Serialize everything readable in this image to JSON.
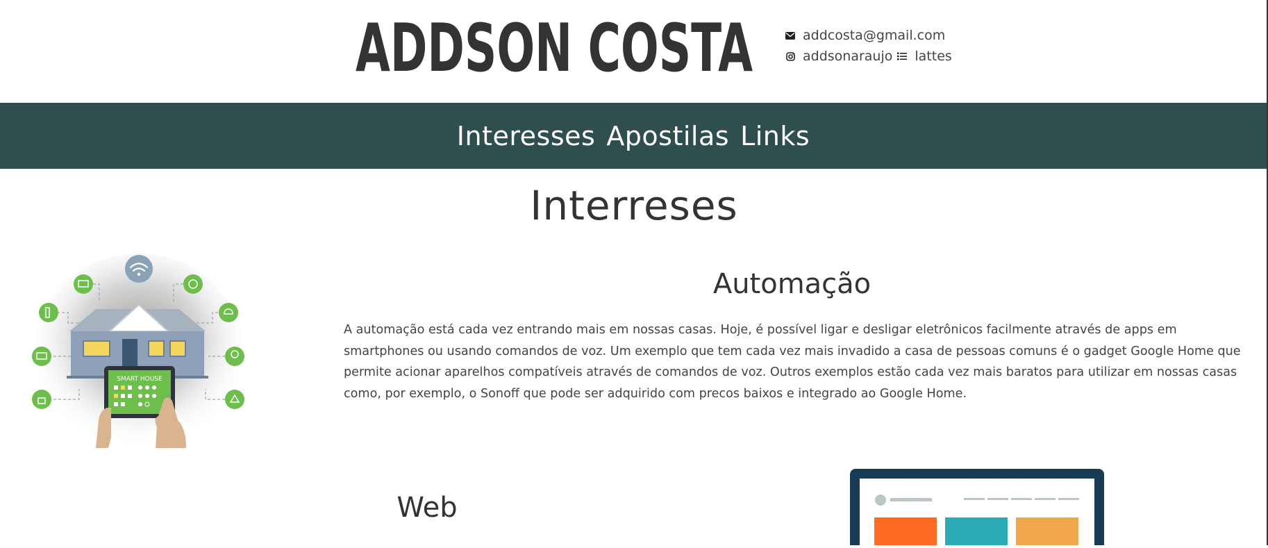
{
  "header": {
    "brand": "ADDSON COSTA",
    "email": "addcosta@gmail.com",
    "instagram": "addsonaraujo",
    "lattes": "lattes",
    "icons": [
      "envelope-icon",
      "instagram-icon",
      "list-icon"
    ]
  },
  "nav": {
    "items": [
      {
        "label": "Interesses"
      },
      {
        "label": "Apostilas"
      },
      {
        "label": "Links"
      }
    ]
  },
  "main": {
    "title": "Interreses",
    "automacao": {
      "title": "Automação",
      "text": "A automação está cada vez entrando mais em nossas casas. Hoje, é possível ligar e desligar eletrônicos facilmente através de apps em smartphones ou usando comandos de voz. Um exemplo que tem cada vez mais invadido a casa de pessoas comuns é o gadget Google Home que permite acionar aparelhos compatíveis através de comandos de voz. Outros exemplos estão cada vez mais baratos para utilizar em nossas casas como, por exemplo, o Sonoff que pode ser adquirido com precos baixos e integrado ao Google Home.",
      "illustration_label": "SMART HOUSE"
    },
    "web": {
      "title": "Web"
    }
  },
  "colors": {
    "navbar": "#2f4f4f",
    "text": "#333333",
    "green": "#6dbe4b",
    "accent_orange": "#ff6a22",
    "accent_teal": "#2aabb5",
    "accent_yellow": "#f0a84a",
    "monitor": "#173a55"
  }
}
